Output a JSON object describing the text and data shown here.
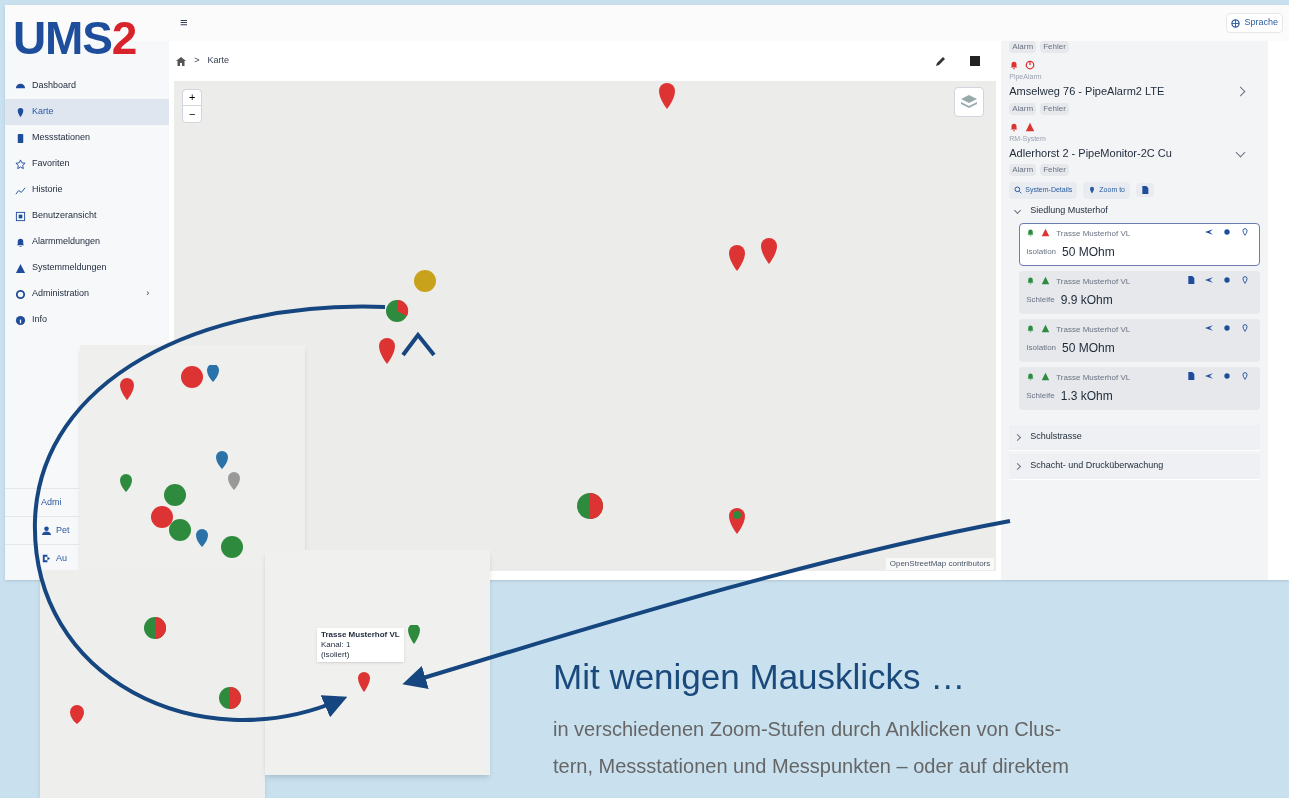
{
  "logo": {
    "text": "UMS",
    "accent": "2"
  },
  "topbar": {
    "menu": "≡",
    "language": "Sprache"
  },
  "sidebar": {
    "items": [
      {
        "label": "Dashboard",
        "selected": false
      },
      {
        "label": "Karte",
        "selected": true
      },
      {
        "label": "Messstationen",
        "selected": false
      },
      {
        "label": "Favoriten",
        "selected": false
      },
      {
        "label": "Historie",
        "selected": false
      },
      {
        "label": "Benutzeransicht",
        "selected": false
      },
      {
        "label": "Alarmmeldungen",
        "selected": false
      },
      {
        "label": "Systemmeldungen",
        "selected": false
      },
      {
        "label": "Administration",
        "selected": false,
        "expand": "›"
      },
      {
        "label": "Info",
        "selected": false
      }
    ],
    "bottom": [
      {
        "label": "Admi"
      },
      {
        "label": "Pet"
      },
      {
        "label": "Au"
      }
    ]
  },
  "breadcrumb": {
    "separator": ">",
    "current": "Karte"
  },
  "map": {
    "zoom_in": "+",
    "zoom_out": "−",
    "attribution": "OpenStreetMap contributors"
  },
  "panel": {
    "systems": [
      {
        "type": "PipeAlarm",
        "name": "Amselweg 76 - PipeAlarm2 LTE",
        "chips": [
          "Alarm",
          "Fehler"
        ],
        "expanded": false
      },
      {
        "type": "RM-System",
        "name": "Adlerhorst 2 - PipeMonitor-2C Cu",
        "chips": [
          "Alarm",
          "Fehler"
        ],
        "expanded": true
      }
    ],
    "top_chips": [
      "Alarm",
      "Fehler"
    ],
    "actions": [
      "System-Details",
      "Zoom to"
    ],
    "groups": [
      {
        "name": "Siedlung Musterhof",
        "expanded": true,
        "points": [
          {
            "name": "Trasse Musterhof VL",
            "measure": "Isolation",
            "value": "50 MOhm",
            "alarm": true,
            "document": false,
            "selected": true
          },
          {
            "name": "Trasse Musterhof VL",
            "measure": "Schleife",
            "value": "9.9 kOhm",
            "alarm": false,
            "document": true,
            "selected": false
          },
          {
            "name": "Trasse Musterhof VL",
            "measure": "Isolation",
            "value": "50 MOhm",
            "alarm": false,
            "document": false,
            "selected": false
          },
          {
            "name": "Trasse Musterhof VL",
            "measure": "Schleife",
            "value": "1.3 kOhm",
            "alarm": false,
            "document": true,
            "selected": false
          }
        ]
      },
      {
        "name": "Schulstrasse",
        "expanded": false
      },
      {
        "name": "Schacht- und Drucküberwachung",
        "expanded": false
      }
    ]
  },
  "tooltip": {
    "lines": [
      "Trasse Musterhof VL",
      "Kanal: 1",
      "(isoliert)"
    ]
  },
  "headline": "Mit wenigen Mausklicks …",
  "body_lines": [
    "in verschiedenen Zoom-Stufen durch Anklicken von Clus-",
    "tern, Messstationen und Messpunkten – oder auf direktem"
  ]
}
